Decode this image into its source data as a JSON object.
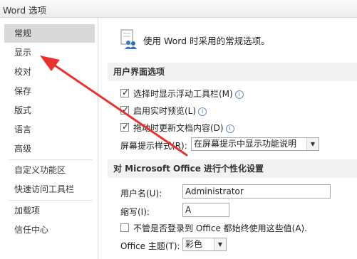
{
  "window": {
    "title": "Word 选项"
  },
  "sidebar": {
    "items": [
      {
        "label": "常规",
        "selected": true
      },
      {
        "label": "显示"
      },
      {
        "label": "校对"
      },
      {
        "label": "保存"
      },
      {
        "label": "版式"
      },
      {
        "label": "语言"
      },
      {
        "label": "高级"
      },
      {
        "label": "自定义功能区"
      },
      {
        "label": "快速访问工具栏"
      },
      {
        "label": "加载项"
      },
      {
        "label": "信任中心"
      }
    ]
  },
  "main": {
    "intro": "使用 Word 时采用的常规选项。",
    "ui_section": {
      "header": "用户界面选项",
      "options": [
        {
          "label": "选择时显示浮动工具栏(M)",
          "checked": true
        },
        {
          "label": "启用实时预览(L)",
          "checked": true
        },
        {
          "label": "拖动时更新文档内容(D)",
          "checked": true
        }
      ],
      "screentip_label": "屏幕提示样式(R):",
      "screentip_value": "在屏幕提示中显示功能说明"
    },
    "personalize_section": {
      "header": "对 Microsoft Office 进行个性化设置",
      "username_label": "用户名(U):",
      "username_value": "Administrator",
      "initials_label": "缩写(I):",
      "initials_value": "A",
      "always_use_label": "不管是否登录到 Office 都始终使用这些值(A).",
      "always_use_checked": false,
      "theme_label": "Office 主题(T):",
      "theme_value": "彩色"
    }
  },
  "annotation": {
    "arrow_color": "#e8322e"
  }
}
